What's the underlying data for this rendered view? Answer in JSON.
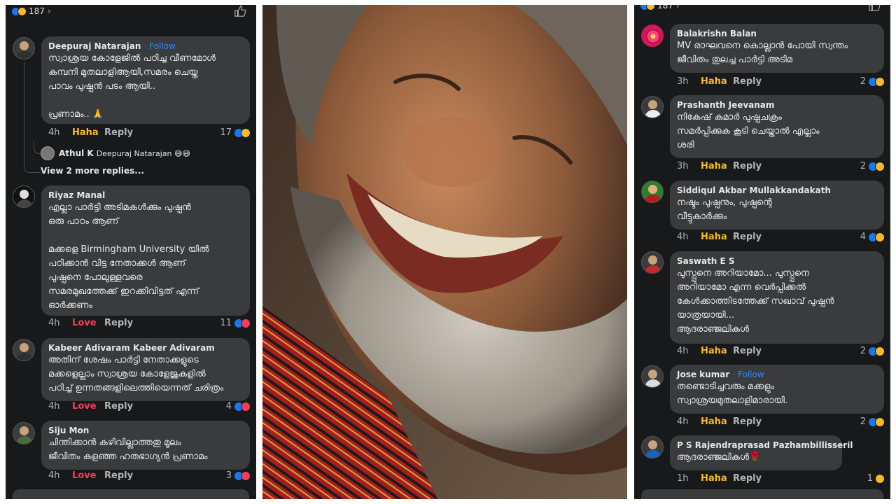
{
  "left_panel": {
    "reaction_count": "187",
    "comments": [
      {
        "name": "Deepuraj Natarajan",
        "follow": "· Follow",
        "text": "സ്വാശ്രയ കോളേജിൽ പഠിച്ച വീണമോൾ\nകമ്പനി മുതലാളിആയി,സമരം ചെയ്ത\nപാവം പുഷ്പൻ പടം ആയി..\n\nപ്രണാമം.. 🙏",
        "time": "4h",
        "reaction": "Haha",
        "reply": "Reply",
        "count": "17"
      },
      {
        "name": "Riyaz Manal",
        "text": "എല്ലാ പാർട്ടി അടിമകൾക്കും പുഷ്പൻ\nഒരു പാഠം ആണ്\n\nമക്കളെ  Birmingham University യിൽ\nപഠിക്കാൻ വിട്ട നേതാക്കൾ ആണ്\nപുഷ്പനെ പോലുള്ളവരെ\nസമരമുഖത്തേക്ക് ഇറക്കിവിട്ടത് എന്ന്\nഓർക്കണം",
        "time": "4h",
        "reaction": "Love",
        "reply": "Reply",
        "count": "11"
      },
      {
        "name": "Kabeer Adivaram Kabeer Adivaram",
        "text": "അതിന് ശേഷം പാർട്ടി നേതാക്കളുടെ\nമക്കളെല്ലാം സ്വാശ്രയ കോളേജുകളിൽ\nപഠിച്ച് ഉന്നതങ്ങളിലെത്തിയെന്നത് ചരിത്രം",
        "time": "4h",
        "reaction": "Love",
        "reply": "Reply",
        "count": "4"
      },
      {
        "name": "Siju Mon",
        "text": "ചിന്തിക്കാൻ കഴിവില്ലാത്തതു മൂലം\nജീവിതം കളഞ്ഞ ഹതഭാഗ്യൻ പ്രണാമം",
        "time": "4h",
        "reaction": "Love",
        "reply": "Reply",
        "count": "3"
      }
    ],
    "subreply": {
      "name": "Athul K",
      "text": "Deepuraj Natarajan 😅😅"
    },
    "view_more": "View 2 more replies..."
  },
  "right_panel": {
    "reaction_count": "187",
    "comments": [
      {
        "name": "Balakrishn Balan",
        "text": "MV രാഘവനെ കൊല്ലാൻ പോയി സ്വന്തം\nജീവിതം തുലച്ച പാർട്ടി അടിമ",
        "time": "3h",
        "reaction": "Haha",
        "reply": "Reply",
        "count": "2"
      },
      {
        "name": "Prashanth Jeevanam",
        "text": "നികേഷ് കുമാർ പുഷ്പചക്രം\nസമർപ്പിക്കുക കൂടി ചെയ്താൽ എല്ലാം\nശരി",
        "time": "3h",
        "reaction": "Haha",
        "reply": "Reply",
        "count": "2"
      },
      {
        "name": "Siddiqul Akbar Mullakkandakath",
        "text": "നഷ്ടം പുഷ്പനും, പുഷ്പന്റെ\nവീട്ടുകാർക്കും",
        "time": "4h",
        "reaction": "Haha",
        "reply": "Reply",
        "count": "4"
      },
      {
        "name": "Saswath E S",
        "text": "പുസ്പ്പനെ അറിയാമോ... പുസ്പ്പനെ\nഅറിയാമോ എന്ന വെർപ്പിക്കൽ\nകേൾക്കാത്തിടത്തേക്ക് സഖാവ് പുഷ്പൻ\nയാത്രയായി...\nആദരാഞ്ജലികൾ",
        "time": "4h",
        "reaction": "Haha",
        "reply": "Reply",
        "count": "2"
      },
      {
        "name": "Jose kumar",
        "follow": "· Follow",
        "text": "തണ്ടൊടിച്ചവരും മക്കളും\nസ്വാശ്രയമുതലാളിമാരായി.",
        "time": "4h",
        "reaction": "Haha",
        "reply": "Reply",
        "count": "2"
      },
      {
        "name": "P S Rajendraprasad Pazhambillisseril",
        "text": "ആദരാഞ്ജലികൾ🌹",
        "time": "1h",
        "reaction": "Haha",
        "reply": "Reply",
        "count": "1"
      }
    ]
  },
  "colors": {
    "panel_bg": "#18191a",
    "bubble_bg": "#3a3b3c",
    "haha": "#f7b928",
    "love": "#f33e58",
    "link": "#2d88ff"
  }
}
